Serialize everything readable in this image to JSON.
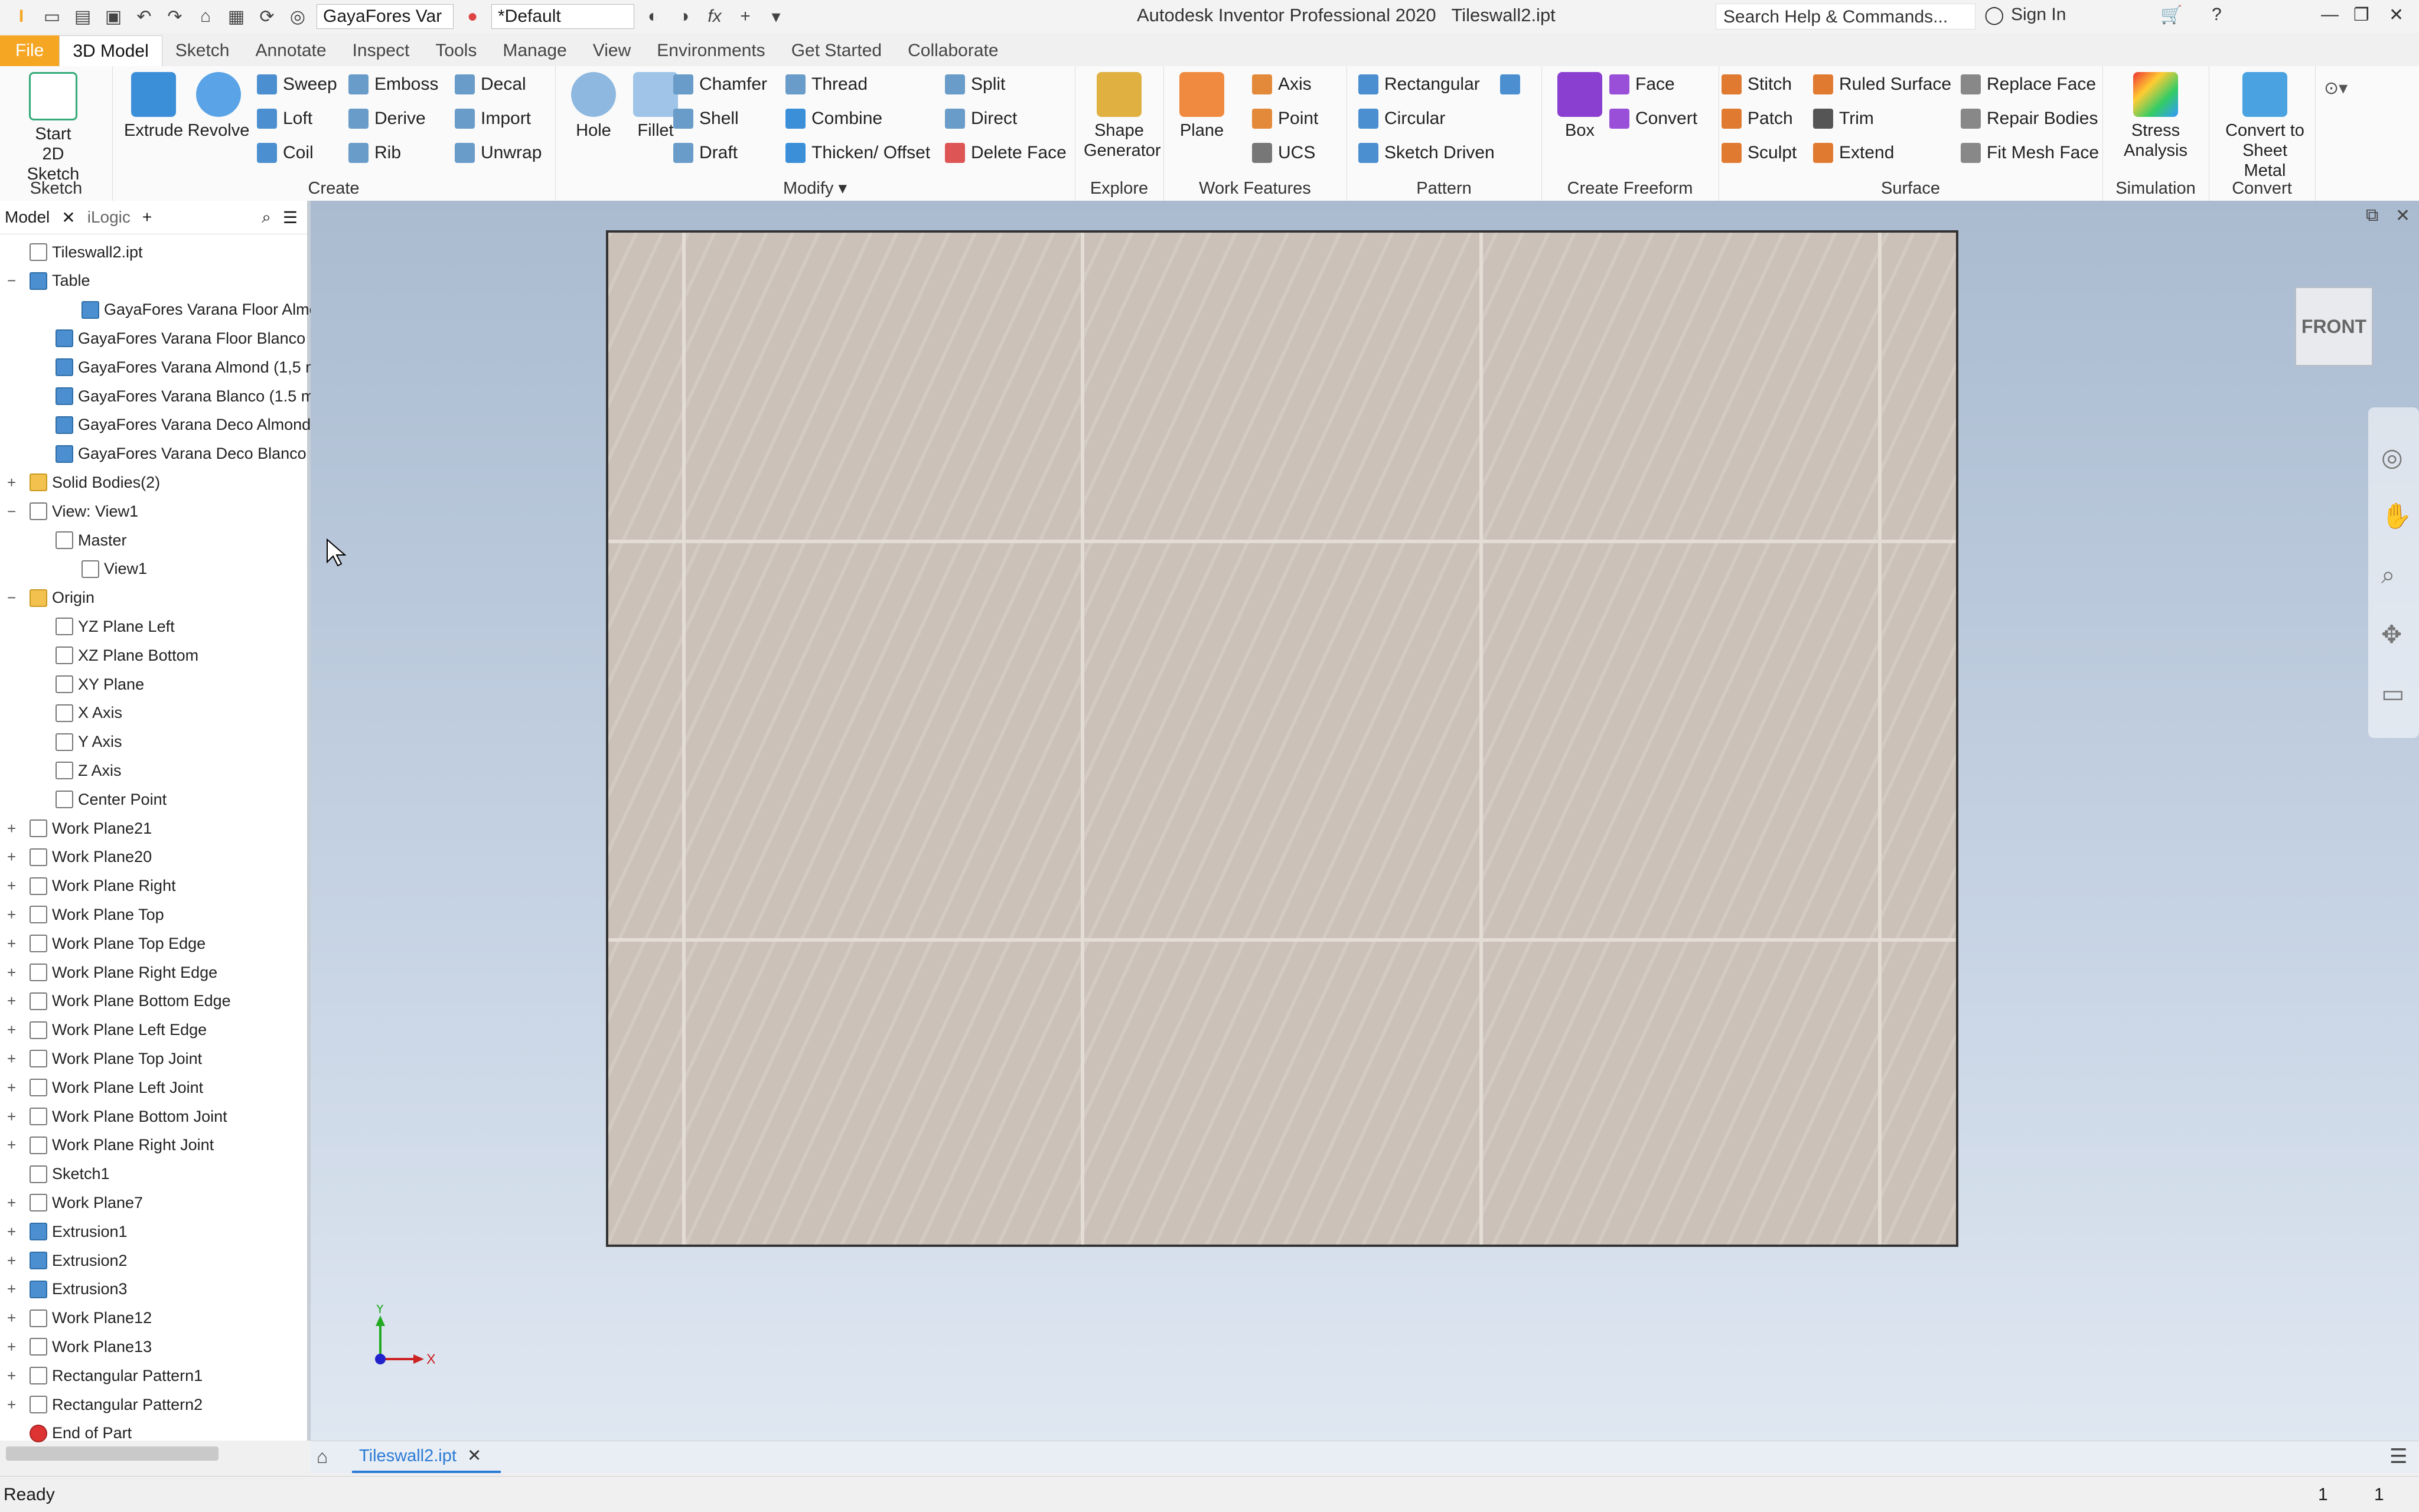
{
  "titlebar": {
    "doc_combo": "GayaFores Var",
    "appearance_combo": "*Default",
    "app_title": "Autodesk Inventor Professional 2020",
    "file_title": "Tileswall2.ipt",
    "search_placeholder": "Search Help & Commands...",
    "sign_in": "Sign In"
  },
  "tabs": [
    "File",
    "3D Model",
    "Sketch",
    "Annotate",
    "Inspect",
    "Tools",
    "Manage",
    "View",
    "Environments",
    "Get Started",
    "Collaborate"
  ],
  "ribbon": {
    "sketch": {
      "label": "Sketch",
      "start": "Start\n2D Sketch"
    },
    "create": {
      "label": "Create",
      "extrude": "Extrude",
      "revolve": "Revolve",
      "sweep": "Sweep",
      "loft": "Loft",
      "coil": "Coil",
      "emboss": "Emboss",
      "derive": "Derive",
      "rib": "Rib",
      "decal": "Decal",
      "import": "Import",
      "unwrap": "Unwrap"
    },
    "modify": {
      "label": "Modify",
      "hole": "Hole",
      "fillet": "Fillet",
      "chamfer": "Chamfer",
      "shell": "Shell",
      "draft": "Draft",
      "thread": "Thread",
      "combine": "Combine",
      "thicken": "Thicken/ Offset",
      "split": "Split",
      "direct": "Direct",
      "delete_face": "Delete Face"
    },
    "explore": {
      "label": "Explore",
      "shape_generator": "Shape\nGenerator"
    },
    "work_features": {
      "label": "Work Features",
      "plane": "Plane",
      "axis": "Axis",
      "point": "Point",
      "ucs": "UCS"
    },
    "pattern": {
      "label": "Pattern",
      "rectangular": "Rectangular",
      "circular": "Circular",
      "sketch_driven": "Sketch Driven"
    },
    "freeform": {
      "label": "Create Freeform",
      "box": "Box",
      "face": "Face",
      "convert": "Convert"
    },
    "surface": {
      "label": "Surface",
      "stitch": "Stitch",
      "patch": "Patch",
      "sculpt": "Sculpt",
      "ruled_surface": "Ruled Surface",
      "trim": "Trim",
      "extend": "Extend",
      "replace_face": "Replace Face",
      "repair_bodies": "Repair Bodies",
      "fit_mesh_face": "Fit Mesh Face"
    },
    "simulation": {
      "label": "Simulation",
      "stress": "Stress\nAnalysis"
    },
    "convert": {
      "label": "Convert",
      "sheet_metal": "Convert to\nSheet Metal"
    }
  },
  "browser": {
    "tab_model": "Model",
    "tab_logic": "iLogic",
    "items": [
      {
        "text": "Tileswall2.ipt",
        "level": 0,
        "exp": ""
      },
      {
        "text": "Table",
        "level": 0,
        "exp": "−"
      },
      {
        "text": "GayaFores Varana Floor Almc",
        "level": 2,
        "exp": ""
      },
      {
        "text": "GayaFores Varana Floor Blanco (",
        "level": 1,
        "exp": ""
      },
      {
        "text": "GayaFores Varana Almond (1,5 m",
        "level": 1,
        "exp": ""
      },
      {
        "text": "GayaFores Varana Blanco (1.5 m",
        "level": 1,
        "exp": ""
      },
      {
        "text": "GayaFores Varana Deco Almond",
        "level": 1,
        "exp": ""
      },
      {
        "text": "GayaFores Varana Deco Blanco (",
        "level": 1,
        "exp": ""
      },
      {
        "text": "Solid Bodies(2)",
        "level": 0,
        "exp": "+"
      },
      {
        "text": "View: View1",
        "level": 0,
        "exp": "−"
      },
      {
        "text": "Master",
        "level": 1,
        "exp": ""
      },
      {
        "text": "View1",
        "level": 2,
        "exp": ""
      },
      {
        "text": "Origin",
        "level": 0,
        "exp": "−"
      },
      {
        "text": "YZ Plane Left",
        "level": 1,
        "exp": ""
      },
      {
        "text": "XZ Plane Bottom",
        "level": 1,
        "exp": ""
      },
      {
        "text": "XY Plane",
        "level": 1,
        "exp": ""
      },
      {
        "text": "X Axis",
        "level": 1,
        "exp": ""
      },
      {
        "text": "Y Axis",
        "level": 1,
        "exp": ""
      },
      {
        "text": "Z Axis",
        "level": 1,
        "exp": ""
      },
      {
        "text": "Center Point",
        "level": 1,
        "exp": ""
      },
      {
        "text": "Work Plane21",
        "level": 0,
        "exp": "+"
      },
      {
        "text": "Work Plane20",
        "level": 0,
        "exp": "+"
      },
      {
        "text": "Work Plane Right",
        "level": 0,
        "exp": "+"
      },
      {
        "text": "Work Plane Top",
        "level": 0,
        "exp": "+"
      },
      {
        "text": "Work Plane Top Edge",
        "level": 0,
        "exp": "+"
      },
      {
        "text": "Work Plane Right Edge",
        "level": 0,
        "exp": "+"
      },
      {
        "text": "Work Plane Bottom Edge",
        "level": 0,
        "exp": "+"
      },
      {
        "text": "Work Plane Left Edge",
        "level": 0,
        "exp": "+"
      },
      {
        "text": "Work Plane Top Joint",
        "level": 0,
        "exp": "+"
      },
      {
        "text": "Work Plane Left Joint",
        "level": 0,
        "exp": "+"
      },
      {
        "text": "Work Plane Bottom Joint",
        "level": 0,
        "exp": "+"
      },
      {
        "text": "Work Plane Right Joint",
        "level": 0,
        "exp": "+"
      },
      {
        "text": "Sketch1",
        "level": 0,
        "exp": ""
      },
      {
        "text": "Work Plane7",
        "level": 0,
        "exp": "+"
      },
      {
        "text": "Extrusion1",
        "level": 0,
        "exp": "+"
      },
      {
        "text": "Extrusion2",
        "level": 0,
        "exp": "+"
      },
      {
        "text": "Extrusion3",
        "level": 0,
        "exp": "+"
      },
      {
        "text": "Work Plane12",
        "level": 0,
        "exp": "+"
      },
      {
        "text": "Work Plane13",
        "level": 0,
        "exp": "+"
      },
      {
        "text": "Rectangular Pattern1",
        "level": 0,
        "exp": "+"
      },
      {
        "text": "Rectangular Pattern2",
        "level": 0,
        "exp": "+"
      },
      {
        "text": "End of Part",
        "level": 0,
        "exp": ""
      }
    ]
  },
  "viewport": {
    "viewcube": "FRONT",
    "axis_x": "X",
    "axis_y": "Y"
  },
  "doc_tab": "Tileswall2.ipt",
  "status": {
    "text": "Ready",
    "n1": "1",
    "n2": "1"
  },
  "colors": {
    "file_tab": "#f5a623",
    "viewport_top": "#aabbd0",
    "tile": "#cfc5bc"
  }
}
